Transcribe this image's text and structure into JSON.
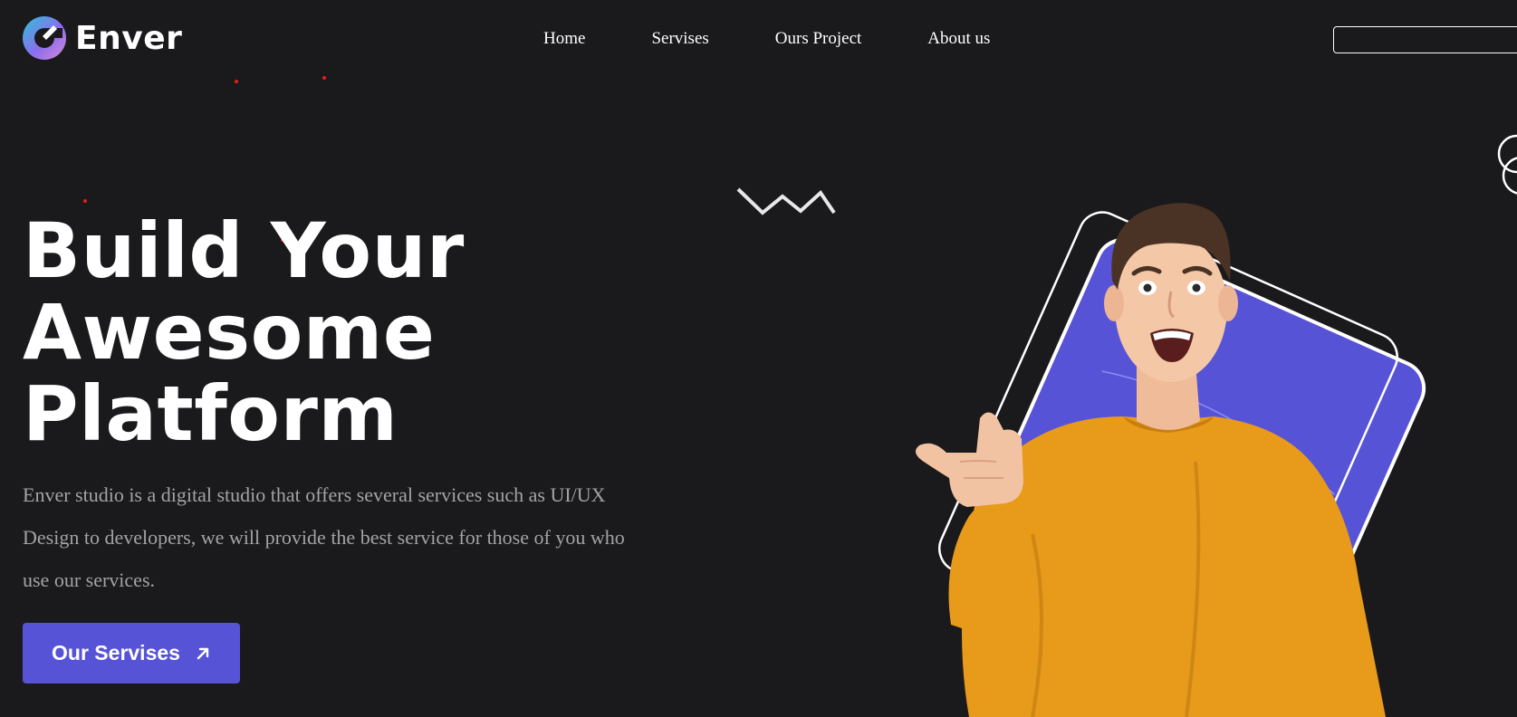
{
  "brand": {
    "name": "Enver",
    "logo_icon": "enver-logo-icon",
    "logo_gradient": [
      "#2ec4d6",
      "#8b6cf0",
      "#d58bd6"
    ]
  },
  "nav": {
    "items": [
      {
        "label": "Home"
      },
      {
        "label": "Servises"
      },
      {
        "label": "Ours Project"
      },
      {
        "label": "About us"
      }
    ]
  },
  "search": {
    "value": "",
    "placeholder": ""
  },
  "hero": {
    "title_lines": [
      "Build Your",
      "Awesome",
      "Platform"
    ],
    "description": "Enver studio is a digital studio that offers several services such as UI/UX Design to developers, we will provide the best service for those of you who use our services.",
    "cta_label": "Our Servises",
    "cta_icon": "arrow-up-right-icon"
  },
  "colors": {
    "background": "#1a1a1c",
    "accent": "#5753d6",
    "text": "#ffffff",
    "muted_text": "#a3a3a6",
    "sweater": "#e89a1a",
    "decor_dot": "#e0201a"
  }
}
